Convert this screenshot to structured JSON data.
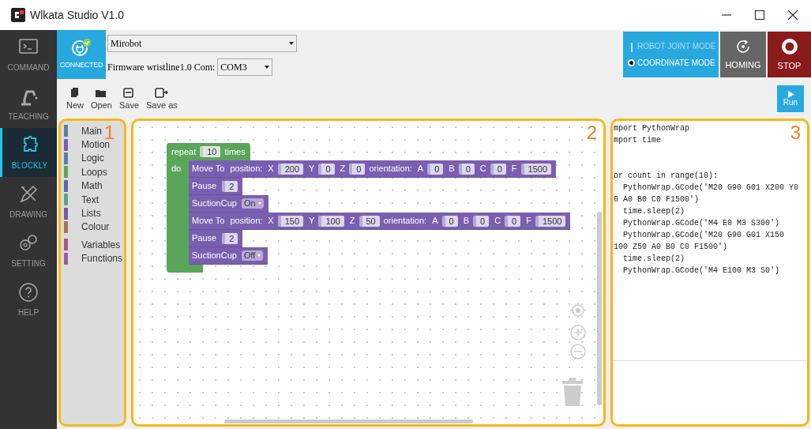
{
  "window": {
    "title": "Wlkata Studio V1.0"
  },
  "nav": [
    {
      "label": "COMMAND",
      "selected": false
    },
    {
      "label": "TEACHING",
      "selected": false
    },
    {
      "label": "BLOCKLY",
      "selected": true
    },
    {
      "label": "DRAWING",
      "selected": false
    },
    {
      "label": "SETTING",
      "selected": false
    },
    {
      "label": "HELP",
      "selected": false
    }
  ],
  "connection": {
    "status": "CONNECTED",
    "device": "Mirobot",
    "firmware_label": "Firmware wristline1.0 Com:",
    "port": "COM3"
  },
  "mode": {
    "options": [
      {
        "label": "ROBOT JOINT MODE",
        "selected": false
      },
      {
        "label": "COORDINATE MODE",
        "selected": true
      }
    ]
  },
  "homing": "HOMING",
  "stop": "STOP",
  "toolbar": [
    {
      "label": "New"
    },
    {
      "label": "Open"
    },
    {
      "label": "Save"
    },
    {
      "label": "Save as"
    }
  ],
  "run": "Run",
  "annotations": [
    "1",
    "2",
    "3"
  ],
  "toolbox": [
    [
      {
        "label": "Main",
        "color": "#5b80a5"
      },
      {
        "label": "Motion",
        "color": "#7a5fb0"
      },
      {
        "label": "Logic",
        "color": "#5b80a5"
      },
      {
        "label": "Loops",
        "color": "#5ba55b"
      },
      {
        "label": "Math",
        "color": "#5b67a5"
      },
      {
        "label": "Text",
        "color": "#5ba58c"
      },
      {
        "label": "Lists",
        "color": "#745ba5"
      },
      {
        "label": "Colour",
        "color": "#a5745b"
      }
    ],
    [
      {
        "label": "Variables",
        "color": "#a55b80"
      },
      {
        "label": "Functions",
        "color": "#995ba5"
      }
    ]
  ],
  "workspace": {
    "repeat": {
      "label": "repeat",
      "count": "10",
      "suffix": "times",
      "do_label": "do",
      "statements": [
        {
          "kind": "move",
          "label": "Move To",
          "parts": [
            {
              "kind": "text",
              "text": "position:"
            },
            {
              "kind": "input",
              "name": "X",
              "value": "200"
            },
            {
              "kind": "input",
              "name": "Y",
              "value": "0"
            },
            {
              "kind": "input",
              "name": "Z",
              "value": "0"
            },
            {
              "kind": "text",
              "text": "orientation:"
            },
            {
              "kind": "input",
              "name": "A",
              "value": "0"
            },
            {
              "kind": "input",
              "name": "B",
              "value": "0"
            },
            {
              "kind": "input",
              "name": "C",
              "value": "0"
            },
            {
              "kind": "input",
              "name": "F",
              "value": "1500"
            }
          ]
        },
        {
          "kind": "pause",
          "label": "Pause",
          "parts": [
            {
              "kind": "input",
              "value": "2"
            }
          ]
        },
        {
          "kind": "suction",
          "label": "SuctionCup",
          "parts": [
            {
              "kind": "dropdown",
              "value": "On"
            }
          ]
        },
        {
          "kind": "move",
          "label": "Move To",
          "parts": [
            {
              "kind": "text",
              "text": "position:"
            },
            {
              "kind": "input",
              "name": "X",
              "value": "150"
            },
            {
              "kind": "input",
              "name": "Y",
              "value": "100"
            },
            {
              "kind": "input",
              "name": "Z",
              "value": "50"
            },
            {
              "kind": "text",
              "text": "orientation:"
            },
            {
              "kind": "input",
              "name": "A",
              "value": "0"
            },
            {
              "kind": "input",
              "name": "B",
              "value": "0"
            },
            {
              "kind": "input",
              "name": "C",
              "value": "0"
            },
            {
              "kind": "input",
              "name": "F",
              "value": "1500"
            }
          ]
        },
        {
          "kind": "pause",
          "label": "Pause",
          "parts": [
            {
              "kind": "input",
              "value": "2"
            }
          ]
        },
        {
          "kind": "suction",
          "label": "SuctionCup",
          "parts": [
            {
              "kind": "dropdown",
              "value": "Off"
            }
          ]
        }
      ]
    }
  },
  "code": [
    [
      "mport PythonWrap",
      "mport time"
    ],
    [
      "or count in range(10):",
      "  PythonWrap.GCode('M20 G90 G01 X200 Y0",
      "0 A0 B0 C0 F1500')",
      "  time.sleep(2)",
      "  PythonWrap.GCode('M4 E0 M3 S300')",
      "  PythonWrap.GCode('M20 G90 G01 X150",
      "100 Z50 A0 B0 C0 F1500')",
      "  time.sleep(2)",
      "  PythonWrap.GCode('M4 E100 M3 S0')"
    ]
  ]
}
